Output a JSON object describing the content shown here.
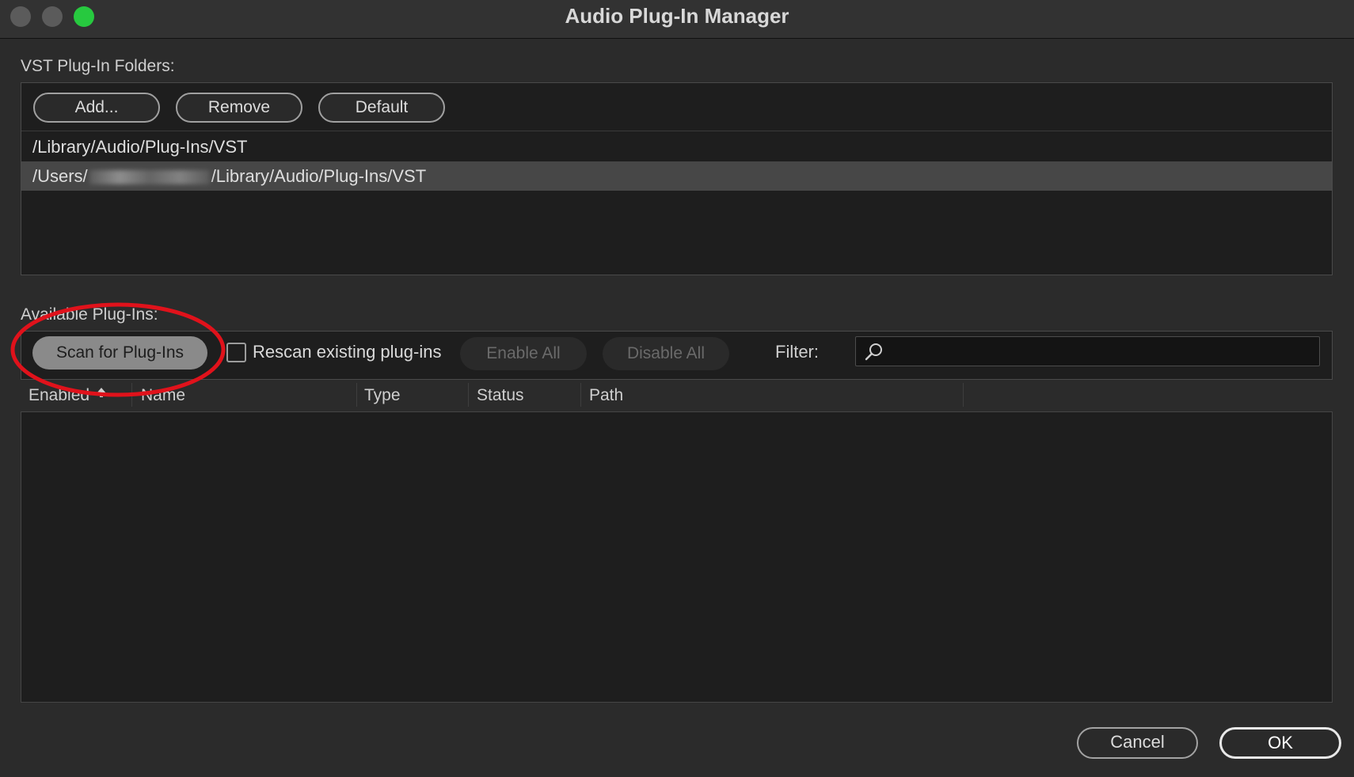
{
  "window": {
    "title": "Audio Plug-In Manager"
  },
  "vst_folders": {
    "label": "VST Plug-In Folders:",
    "buttons": {
      "add": "Add...",
      "remove": "Remove",
      "default": "Default"
    },
    "folders": [
      {
        "prefix": "/Library/Audio/Plug-Ins/VST",
        "suffix": ""
      },
      {
        "prefix": "/Users/",
        "suffix": "/Library/Audio/Plug-Ins/VST"
      }
    ]
  },
  "available": {
    "label": "Available Plug-Ins:",
    "scan_button": "Scan for Plug-Ins",
    "rescan_label": "Rescan existing plug-ins",
    "rescan_checked": false,
    "enable_all": "Enable All",
    "disable_all": "Disable All",
    "filter_label": "Filter:",
    "filter_value": "",
    "columns": [
      "Enabled",
      "Name",
      "Type",
      "Status",
      "Path"
    ]
  },
  "footer": {
    "cancel": "Cancel",
    "ok": "OK"
  },
  "colors": {
    "accent_ok": "#27c93f",
    "annotation": "#e0121b"
  }
}
